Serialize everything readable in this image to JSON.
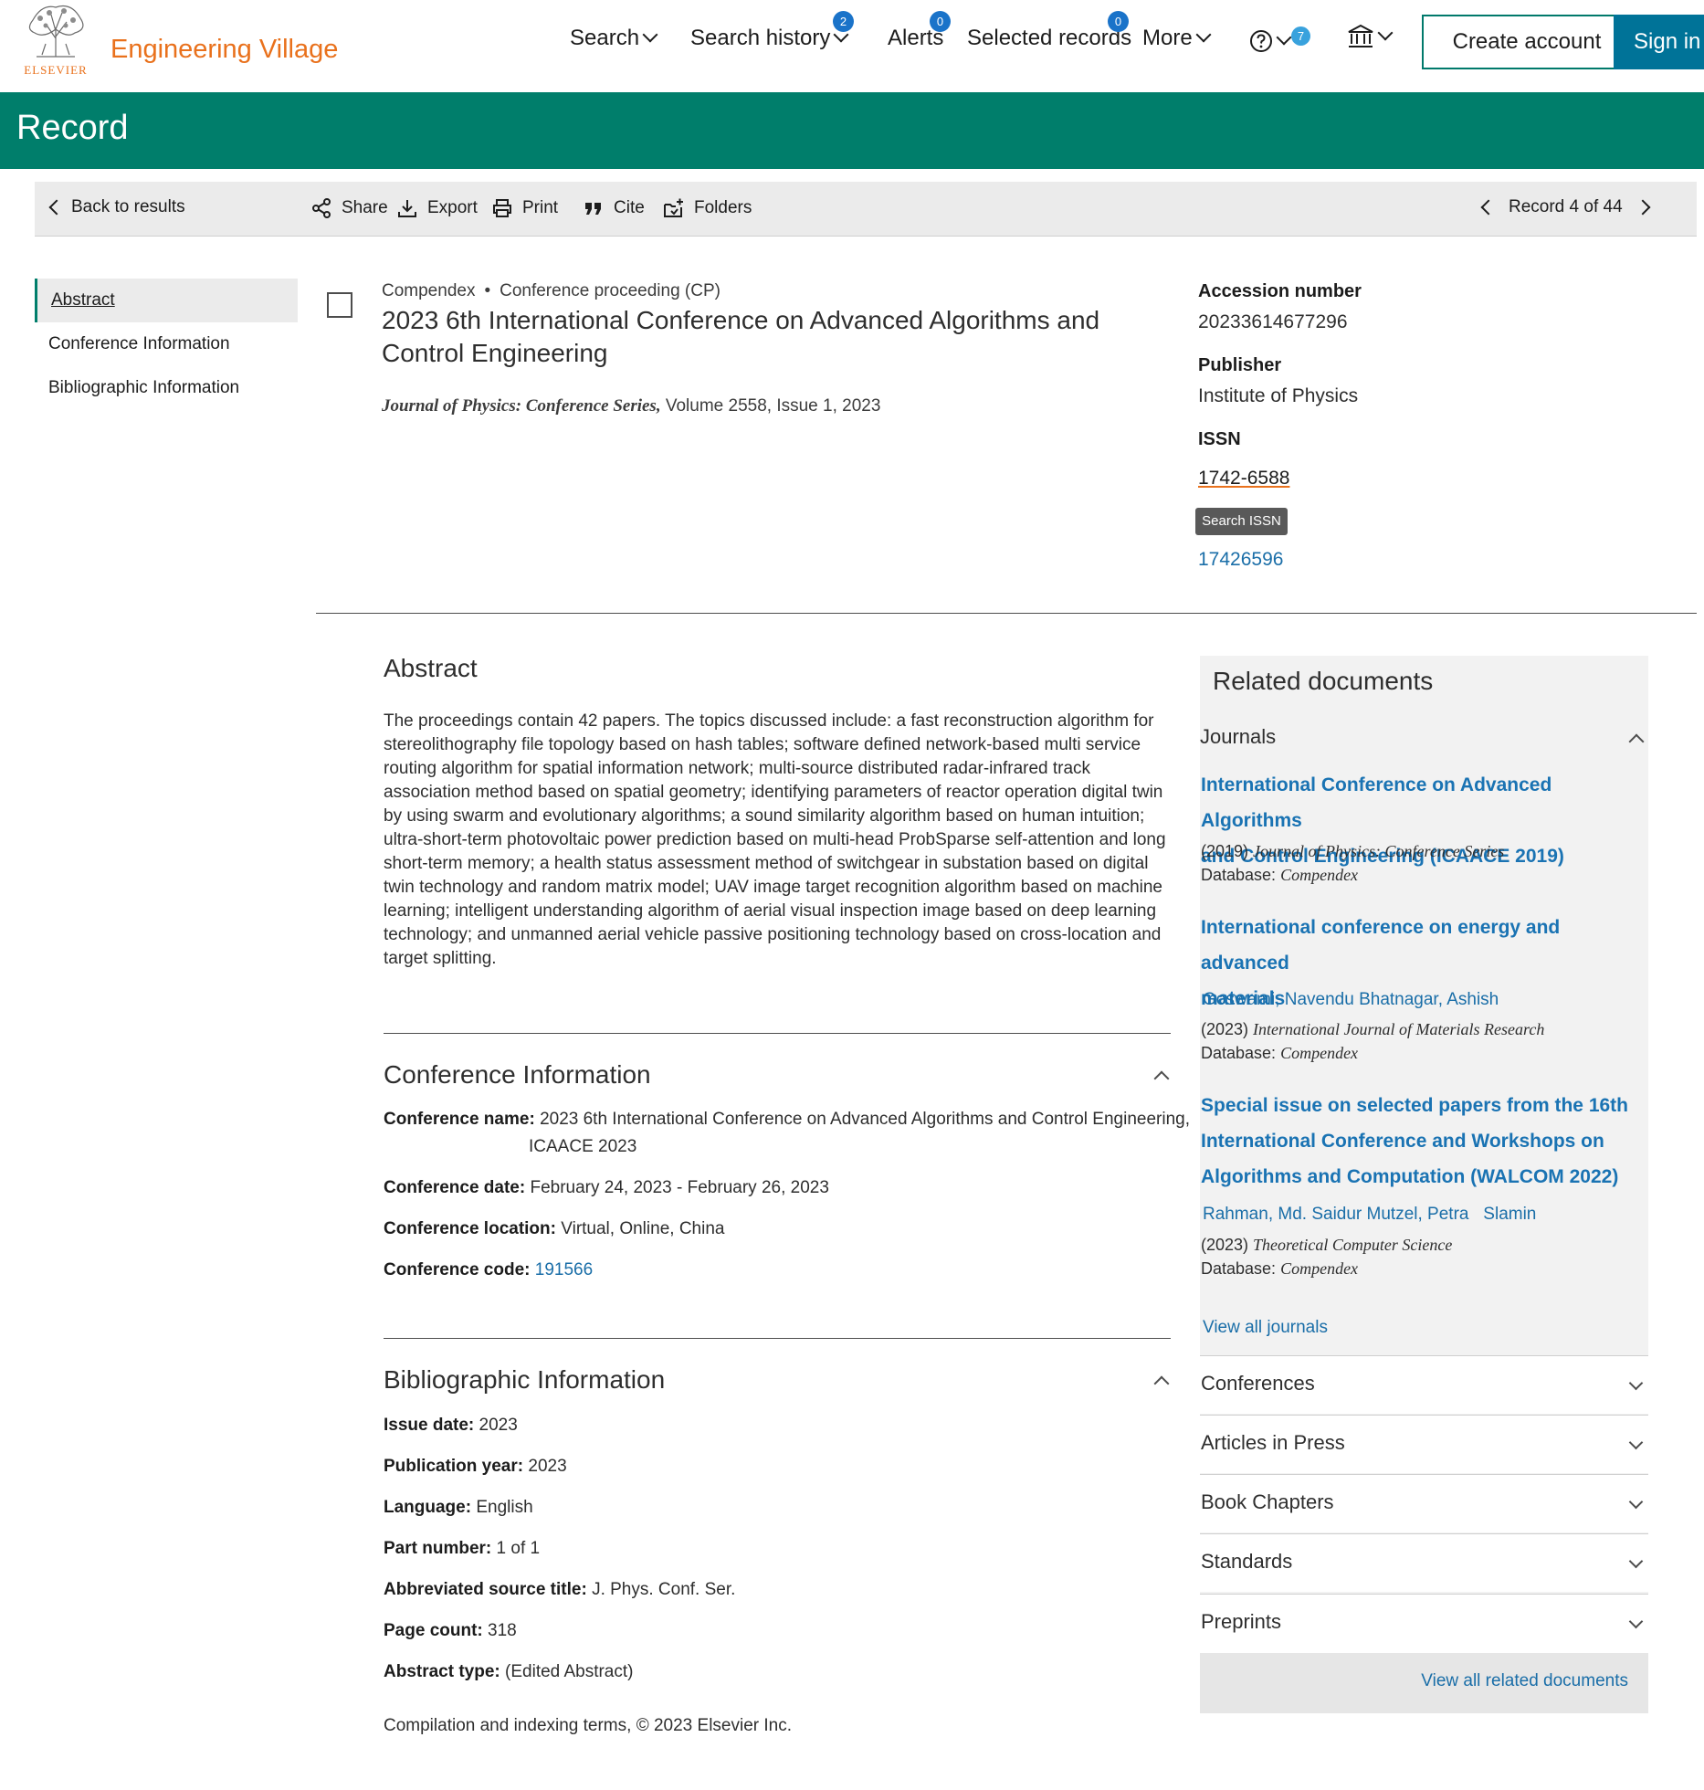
{
  "header": {
    "logo_text": "ELSEVIER",
    "brand": "Engineering Village",
    "nav": {
      "search": "Search",
      "search_history": "Search history",
      "search_history_badge": "2",
      "alerts": "Alerts",
      "alerts_badge": "0",
      "selected_records": "Selected records",
      "selected_records_badge": "0",
      "more": "More",
      "help_badge": "7"
    },
    "create_account": "Create account",
    "sign_in": "Sign in"
  },
  "page_title": "Record",
  "toolbar": {
    "back": "Back to results",
    "share": "Share",
    "export": "Export",
    "print": "Print",
    "cite": "Cite",
    "folders": "Folders",
    "record_position": "Record 4 of 44"
  },
  "left_nav": {
    "abstract": "Abstract",
    "conference": "Conference Information",
    "bibliographic": "Bibliographic Information"
  },
  "record": {
    "database": "Compendex",
    "doc_type": "Conference proceeding (CP)",
    "title": "2023 6th International Conference on Advanced Algorithms and Control Engineering",
    "source_title": "Journal of Physics: Conference Series,",
    "source_detail": " Volume 2558, Issue 1, 2023",
    "accession_label": "Accession number",
    "accession_number": "20233614677296",
    "publisher_label": "Publisher",
    "publisher": "Institute of Physics",
    "issn_label": "ISSN",
    "issn": "1742-6588",
    "issn_tooltip": "Search ISSN",
    "eissn": "17426596"
  },
  "abstract": {
    "heading": "Abstract",
    "text": "The proceedings contain 42 papers. The topics discussed include: a fast reconstruction algorithm for stereolithography file topology based on hash tables; software defined network-based multi service routing algorithm for spatial information network; multi-source distributed radar-infrared track association method based on spatial geometry; identifying parameters of reactor operation digital twin by using swarm and evolutionary algorithms; a sound similarity algorithm based on human intuition; ultra-short-term photovoltaic power prediction based on multi-head ProbSparse self-attention and long short-term memory; a health status assessment method of switchgear in substation based on digital twin technology and random matrix model; UAV image target recognition algorithm based on machine learning; intelligent understanding algorithm of aerial visual inspection image based on deep learning technology; and unmanned aerial vehicle passive positioning technology based on cross-location and target splitting."
  },
  "conference": {
    "heading": "Conference Information",
    "name_label": "Conference name:",
    "name_line1": "2023 6th International Conference on Advanced Algorithms and Control Engineering,",
    "name_line2": "ICAACE 2023",
    "date_label": "Conference date:",
    "date": "February 24, 2023 - February 26, 2023",
    "location_label": "Conference location:",
    "location": "Virtual, Online, China",
    "code_label": "Conference code:",
    "code": "191566"
  },
  "bibliographic": {
    "heading": "Bibliographic Information",
    "issue_date_label": "Issue date:",
    "issue_date": "2023",
    "pub_year_label": "Publication year:",
    "pub_year": "2023",
    "language_label": "Language:",
    "language": "English",
    "part_label": "Part number:",
    "part": "1 of 1",
    "abbrev_label": "Abbreviated source title:",
    "abbrev": "J. Phys. Conf. Ser.",
    "page_count_label": "Page count:",
    "page_count": "318",
    "abstract_type_label": "Abstract type:",
    "abstract_type": "(Edited Abstract)"
  },
  "footer_note": "Compilation and indexing terms, © 2023 Elsevier Inc.",
  "related": {
    "heading": "Related documents",
    "journals_label": "Journals",
    "items": [
      {
        "title_line1": "International Conference on Advanced Algorithms",
        "title_line2": "and Control Engineering (ICAACE 2019)",
        "year": "(2019)",
        "source": "Journal of Physics: Conference Series",
        "db_label": "Database:",
        "db": "Compendex"
      },
      {
        "title_line1": "International conference on energy and advanced",
        "title_line2": "materials",
        "authors": "Goswami, Navendu Bhatnagar, Ashish",
        "year": "(2023)",
        "source": "International Journal of Materials Research",
        "db_label": "Database:",
        "db": "Compendex"
      },
      {
        "title_line1": "Special issue on selected papers from the 16th",
        "title_line2": "International Conference and Workshops on",
        "title_line3": "Algorithms and Computation (WALCOM 2022)",
        "authors": "Rahman, Md. Saidur Mutzel, Petra   Slamin",
        "year": "(2023)",
        "source": "Theoretical Computer Science",
        "db_label": "Database:",
        "db": "Compendex"
      }
    ],
    "view_all_journals": "View all journals",
    "categories": [
      "Conferences",
      "Articles in Press",
      "Book Chapters",
      "Standards",
      "Preprints"
    ],
    "view_all_related": "View all related documents"
  },
  "colors": {
    "brand_orange": "#e9711c",
    "header_green": "#007e6b",
    "link_blue": "#1a73b3",
    "badge_blue": "#1a73c9",
    "signin_blue": "#007398"
  }
}
